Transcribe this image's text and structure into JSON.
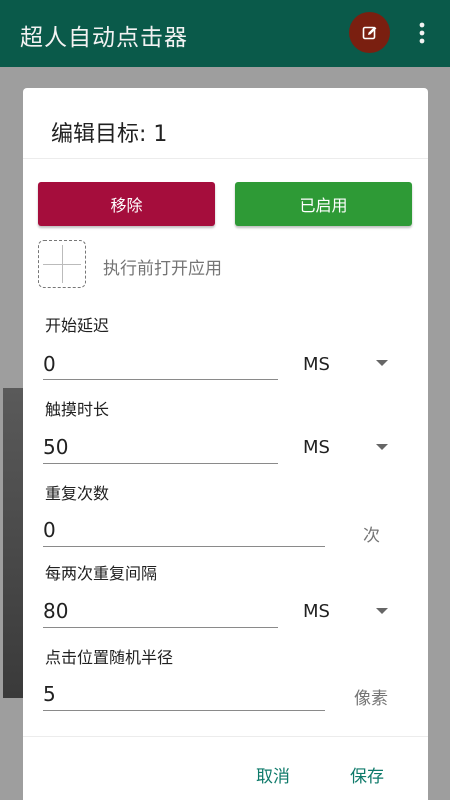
{
  "appbar": {
    "title": "超人自动点击器",
    "bg_color": "#0a5a4a",
    "edit_icon": "edit-icon",
    "more_icon": "more-vert-icon"
  },
  "dialog": {
    "title": "编辑目标: 1",
    "remove_label": "移除",
    "enabled_label": "已启用",
    "open_app_label": "执行前打开应用",
    "fields": {
      "start_delay": {
        "label": "开始延迟",
        "value": "0",
        "unit": "MS"
      },
      "touch_duration": {
        "label": "触摸时长",
        "value": "50",
        "unit": "MS"
      },
      "repeat_count": {
        "label": "重复次数",
        "value": "0",
        "unit": "次"
      },
      "repeat_interval": {
        "label": "每两次重复间隔",
        "value": "80",
        "unit": "MS"
      },
      "random_radius": {
        "label": "点击位置随机半径",
        "value": "5",
        "unit": "像素"
      }
    },
    "cancel_label": "取消",
    "save_label": "保存"
  },
  "colors": {
    "remove": "#a50d3c",
    "enabled": "#2e9a36",
    "accent": "#0e7a6a"
  }
}
